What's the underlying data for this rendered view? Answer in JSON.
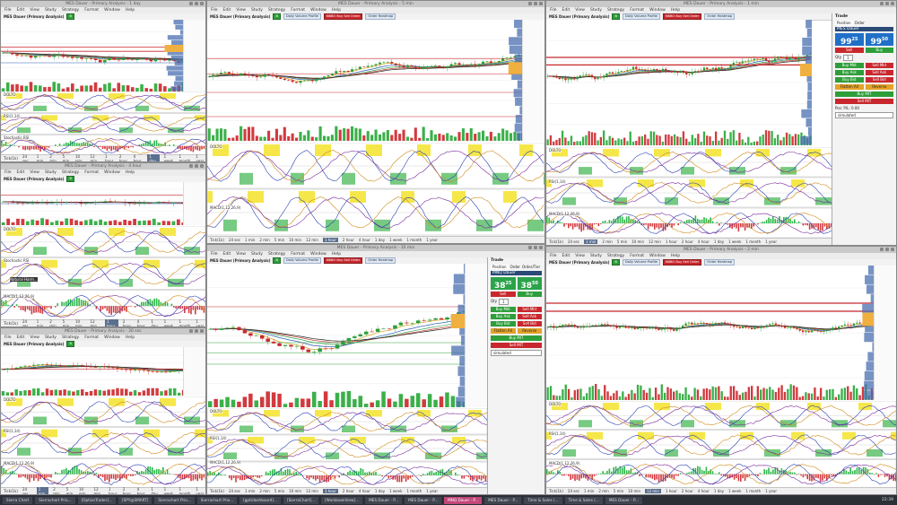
{
  "windows": [
    {
      "id": "w1",
      "title": "MES Dauer - Primary Analysis - 1 day",
      "chart_title": "MES Dauer (Primary Analysis)",
      "menu": [
        "File",
        "Edit",
        "View",
        "Study",
        "Strategy",
        "Format",
        "Window",
        "Help"
      ],
      "timeframes": [
        "Tick(1k)",
        "24 sec",
        "1 min",
        "2 min",
        "5 min",
        "10 min",
        "12 min",
        "1 hour",
        "2 hour",
        "4 hour",
        "1 day",
        "1 week",
        "1 month",
        "1 year"
      ],
      "selected_tf": "1 day",
      "indicators": [
        "DOLTO",
        "RSI(1,14)",
        "Stochastic RSI"
      ]
    },
    {
      "id": "w2",
      "title": "MES Dauer - Primary Analysis - 5 min",
      "chart_title": "MES Dauer (Primary Analysis)",
      "menu": [
        "File",
        "Edit",
        "View",
        "Study",
        "Strategy",
        "Format",
        "Window",
        "Help"
      ],
      "timeframes": [
        "Tick(1k)",
        "24 sec",
        "1 min",
        "2 min",
        "5 min",
        "10 min",
        "12 min",
        "1 hour",
        "2 hour",
        "4 hour",
        "1 day",
        "1 week",
        "1 month",
        "1 year"
      ],
      "selected_tf": "1 hour",
      "indicators": [
        "DOLTO",
        "MACD(1,12,26,9)"
      ],
      "buttons": [
        "Daily Volume Profile",
        "NBBO Buy Sell Order",
        "Order Heatmap"
      ]
    },
    {
      "id": "w3",
      "title": "MES Dauer - Primary Analysis - 1 min",
      "chart_title": "MES Dauer (Primary Analysis)",
      "menu": [
        "File",
        "Edit",
        "View",
        "Study",
        "Strategy",
        "Format",
        "Window",
        "Help"
      ],
      "timeframes": [
        "Tick(1k)",
        "24 sec",
        "1 min",
        "2 min",
        "5 min",
        "10 min",
        "12 min",
        "1 hour",
        "2 hour",
        "4 hour",
        "1 day",
        "1 week",
        "1 month",
        "1 year"
      ],
      "selected_tf": "1 min",
      "indicators": [
        "DOLTO",
        "RSI(1,14)",
        "MACD(1,12,26,9)"
      ]
    },
    {
      "id": "w4",
      "title": "MES Dauer - Primary Analysis - 4 hour",
      "chart_title": "MES Dauer (Primary Analysis)",
      "menu": [
        "File",
        "Edit",
        "View",
        "Study",
        "Strategy",
        "Format",
        "Window",
        "Help"
      ],
      "timeframes": [
        "Tick(1k)",
        "24 sec",
        "1 min",
        "2 min",
        "5 min",
        "10 min",
        "12 min",
        "1 hour",
        "2 hour",
        "4 hour",
        "1 day",
        "1 week",
        "1 month",
        "1 year"
      ],
      "selected_tf": "1 hour",
      "indicators": [
        "DOLTO",
        "Stochastic RSI",
        "MACD(1,12,26,9)"
      ],
      "label": "Natural Harm..."
    },
    {
      "id": "w5",
      "title": "MES Dauer - Primary Analysis - 10 min",
      "chart_title": "MES Dauer (Primary Analysis)",
      "menu": [
        "File",
        "Edit",
        "View",
        "Study",
        "Strategy",
        "Format",
        "Window",
        "Help"
      ],
      "timeframes": [
        "Tick(1k)",
        "24 sec",
        "1 min",
        "2 min",
        "5 min",
        "10 min",
        "12 min",
        "1 hour",
        "2 hour",
        "4 hour",
        "1 day",
        "1 week",
        "1 month",
        "1 year"
      ],
      "selected_tf": "1 hour",
      "indicators": [
        "DOLTO",
        "RSI(1,14)",
        "MACD(1,12,26,9)"
      ]
    },
    {
      "id": "w6",
      "title": "MES Dauer - Primary Analysis - 2 min",
      "chart_title": "MES Dauer (Primary Analysis)",
      "menu": [
        "File",
        "Edit",
        "View",
        "Study",
        "Strategy",
        "Format",
        "Window",
        "Help"
      ],
      "timeframes": [
        "Tick(1k)",
        "24 sec",
        "1 min",
        "2 min",
        "5 min",
        "10 min",
        "12 min",
        "1 hour",
        "2 hour",
        "4 hour",
        "1 day",
        "1 week",
        "1 month",
        "1 year"
      ],
      "selected_tf": "12 min",
      "indicators": [
        "DOLTO",
        "RSI(1,14)",
        "MACD(1,12,26,9)"
      ]
    },
    {
      "id": "w7",
      "title": "MES Dauer - Primary Analysis - 30 sec",
      "chart_title": "MES Dauer (Primary Analysis)",
      "menu": [
        "File",
        "Edit",
        "View",
        "Study",
        "Strategy",
        "Format",
        "Window",
        "Help"
      ],
      "timeframes": [
        "Tick(1k)",
        "24 sec",
        "1 min",
        "2 min",
        "5 min",
        "10 min",
        "12 min",
        "1 hour",
        "2 hour",
        "4 hour",
        "1 day",
        "1 week",
        "1 month",
        "1 year"
      ],
      "selected_tf": "1 min",
      "indicators": [
        "DOLTO",
        "RSI(1,14)",
        "MACD(1,12,26,9)"
      ]
    }
  ],
  "trade_top": {
    "header": "Trade",
    "tabs": [
      "Position",
      "Order"
    ],
    "symbol": "MES Dauer",
    "bid_label": "Sell",
    "ask_label": "Buy",
    "bid": "99",
    "bid_sup": "25",
    "ask": "99",
    "ask_sup": "50",
    "qty_label": "Qty",
    "qty": "1",
    "buttons": [
      "Buy Mkt",
      "Sell Mkt",
      "Buy Ask",
      "Sell Ask",
      "Buy Bid",
      "Sell Bid",
      "Flatten All",
      "Reverse",
      "Buy MIT",
      "Sell MIT"
    ],
    "pl_label": "Pos: P/L: 0.00",
    "account": "simulated"
  },
  "trade_mid": {
    "header": "Trade",
    "tabs": [
      "Position",
      "Order",
      "Order/Tier"
    ],
    "symbol": "MNQ Dauer",
    "bid_label": "Sell",
    "ask_label": "Buy",
    "bid": "38",
    "bid_sup": "25",
    "ask": "38",
    "ask_sup": "50",
    "qty_label": "Qty",
    "qty": "1",
    "buttons": [
      "Buy Mkt",
      "Sell Mkt",
      "Buy Ask",
      "Sell Ask",
      "Buy Bid",
      "Sell Bid",
      "Flatten All",
      "Reverse",
      "Buy MIT",
      "Sell MIT"
    ],
    "account": "simulated"
  },
  "taskbar": {
    "items": [
      "Sierra Chart",
      "Sierrachart Prio...",
      "[OptionTrader]...",
      "[SPY@SMART]",
      "Sierrachart Prio...",
      "Sierrachart Prio...",
      "[gpt/dashboard]...",
      "[SierraChart]...",
      "[WorkbookView]...",
      "MES Dauer - P...",
      "MES Dauer - P...",
      "MNQ Dauer - P...",
      "MES Dauer - P...",
      "Time & Sales (...",
      "Time & Sales (...",
      "MES Dauer - P..."
    ],
    "active_index": 11,
    "clock": "22:39"
  }
}
